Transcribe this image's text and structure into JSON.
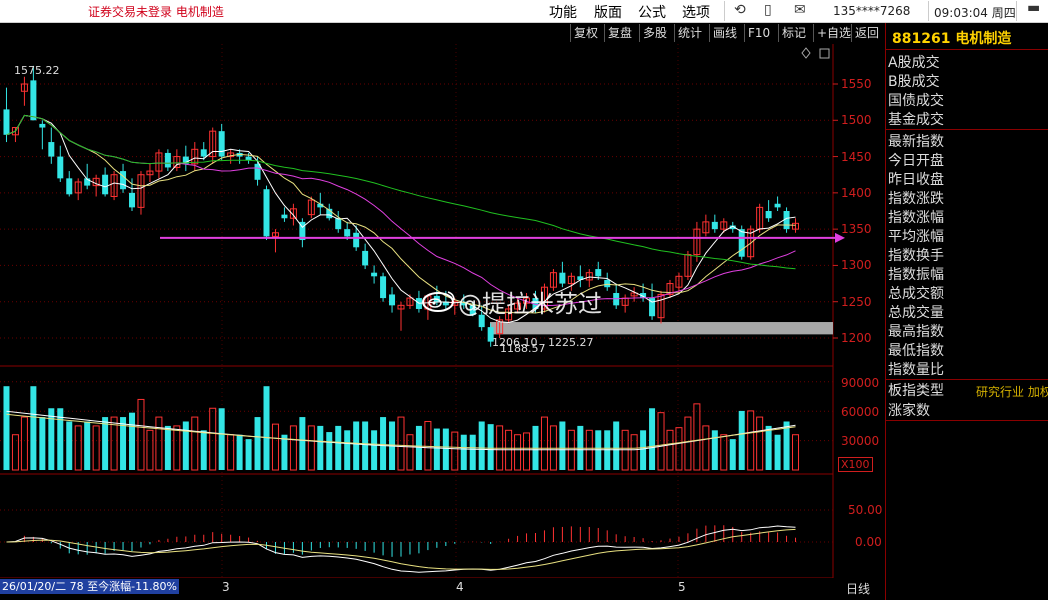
{
  "titlebar": {
    "title": "证券交易未登录   电机制造",
    "menus": [
      "功能",
      "版面",
      "公式",
      "选项"
    ],
    "account": "135****7268",
    "clock": "09:03:04 周四"
  },
  "toolbar": {
    "buttons": [
      "复权",
      "复盘",
      "多股",
      "统计",
      "画线",
      "F10",
      "标记",
      "+自选",
      "返回"
    ]
  },
  "right_panel": {
    "code": "881261",
    "name": "电机制造",
    "rows": [
      "A股成交",
      "B股成交",
      "国债成交",
      "基金成交",
      "最新指数",
      "今日开盘",
      "昨日收盘",
      "指数涨跌",
      "指数涨幅",
      "平均涨幅",
      "指数换手",
      "指数振幅",
      "总成交额",
      "总成交量",
      "最高指数",
      "最低指数",
      "指数量比",
      "板指类型",
      "涨家数"
    ],
    "type_value": "研究行业 加权"
  },
  "price_axis": [
    "1550",
    "1500",
    "1450",
    "1400",
    "1350",
    "1300",
    "1250",
    "1200"
  ],
  "volume_axis": [
    "90000",
    "60000",
    "30000"
  ],
  "volume_unit": "X100",
  "macd_axis": [
    "50.00",
    "0.00"
  ],
  "labels": {
    "high": "1575.22",
    "low": "1188.57",
    "low_pair_a": "1206.10",
    "low_pair_b": "1225.27"
  },
  "watermark": "@提拉米苏过",
  "bottom": {
    "info": "26/01/20/二 78 至今涨幅-11.80%",
    "months": [
      "3",
      "4",
      "5"
    ],
    "period": "日线"
  },
  "colors": {
    "up": "#ff3232",
    "down": "#33e5e5",
    "ma5": "#ffffff",
    "ma10": "#e8e080",
    "ma20": "#e040e0",
    "ma60": "#20c020",
    "hline": "#e040e0"
  },
  "chart_data": {
    "type": "candlestick",
    "ylim": [
      1180,
      1600
    ],
    "candles": [
      {
        "o": 1515,
        "h": 1545,
        "l": 1470,
        "c": 1480
      },
      {
        "o": 1480,
        "h": 1490,
        "l": 1470,
        "c": 1490
      },
      {
        "o": 1540,
        "h": 1560,
        "l": 1520,
        "c": 1550
      },
      {
        "o": 1555,
        "h": 1575,
        "l": 1500,
        "c": 1500
      },
      {
        "o": 1495,
        "h": 1500,
        "l": 1460,
        "c": 1490
      },
      {
        "o": 1470,
        "h": 1490,
        "l": 1440,
        "c": 1450
      },
      {
        "o": 1450,
        "h": 1465,
        "l": 1415,
        "c": 1420
      },
      {
        "o": 1420,
        "h": 1430,
        "l": 1395,
        "c": 1398
      },
      {
        "o": 1400,
        "h": 1420,
        "l": 1390,
        "c": 1415
      },
      {
        "o": 1420,
        "h": 1440,
        "l": 1405,
        "c": 1410
      },
      {
        "o": 1410,
        "h": 1425,
        "l": 1395,
        "c": 1420
      },
      {
        "o": 1425,
        "h": 1435,
        "l": 1395,
        "c": 1398
      },
      {
        "o": 1395,
        "h": 1430,
        "l": 1390,
        "c": 1425
      },
      {
        "o": 1430,
        "h": 1440,
        "l": 1400,
        "c": 1405
      },
      {
        "o": 1400,
        "h": 1420,
        "l": 1375,
        "c": 1380
      },
      {
        "o": 1380,
        "h": 1430,
        "l": 1370,
        "c": 1425
      },
      {
        "o": 1425,
        "h": 1440,
        "l": 1415,
        "c": 1430
      },
      {
        "o": 1430,
        "h": 1460,
        "l": 1420,
        "c": 1455
      },
      {
        "o": 1455,
        "h": 1460,
        "l": 1430,
        "c": 1435
      },
      {
        "o": 1435,
        "h": 1460,
        "l": 1430,
        "c": 1450
      },
      {
        "o": 1450,
        "h": 1465,
        "l": 1430,
        "c": 1440
      },
      {
        "o": 1440,
        "h": 1470,
        "l": 1430,
        "c": 1460
      },
      {
        "o": 1460,
        "h": 1470,
        "l": 1445,
        "c": 1450
      },
      {
        "o": 1450,
        "h": 1490,
        "l": 1440,
        "c": 1485
      },
      {
        "o": 1485,
        "h": 1495,
        "l": 1445,
        "c": 1450
      },
      {
        "o": 1450,
        "h": 1460,
        "l": 1440,
        "c": 1455
      },
      {
        "o": 1455,
        "h": 1460,
        "l": 1440,
        "c": 1450
      },
      {
        "o": 1450,
        "h": 1455,
        "l": 1440,
        "c": 1445
      },
      {
        "o": 1440,
        "h": 1450,
        "l": 1410,
        "c": 1418
      },
      {
        "o": 1405,
        "h": 1410,
        "l": 1335,
        "c": 1340
      },
      {
        "o": 1340,
        "h": 1350,
        "l": 1318,
        "c": 1345
      },
      {
        "o": 1370,
        "h": 1380,
        "l": 1360,
        "c": 1365
      },
      {
        "o": 1365,
        "h": 1385,
        "l": 1355,
        "c": 1378
      },
      {
        "o": 1360,
        "h": 1365,
        "l": 1325,
        "c": 1335
      },
      {
        "o": 1370,
        "h": 1395,
        "l": 1365,
        "c": 1390
      },
      {
        "o": 1385,
        "h": 1400,
        "l": 1370,
        "c": 1380
      },
      {
        "o": 1378,
        "h": 1385,
        "l": 1362,
        "c": 1365
      },
      {
        "o": 1365,
        "h": 1375,
        "l": 1345,
        "c": 1350
      },
      {
        "o": 1350,
        "h": 1360,
        "l": 1335,
        "c": 1340
      },
      {
        "o": 1345,
        "h": 1355,
        "l": 1320,
        "c": 1325
      },
      {
        "o": 1320,
        "h": 1330,
        "l": 1295,
        "c": 1300
      },
      {
        "o": 1290,
        "h": 1300,
        "l": 1275,
        "c": 1285
      },
      {
        "o": 1285,
        "h": 1290,
        "l": 1250,
        "c": 1255
      },
      {
        "o": 1260,
        "h": 1270,
        "l": 1235,
        "c": 1245
      },
      {
        "o": 1240,
        "h": 1250,
        "l": 1210,
        "c": 1245
      },
      {
        "o": 1245,
        "h": 1260,
        "l": 1240,
        "c": 1255
      },
      {
        "o": 1255,
        "h": 1265,
        "l": 1235,
        "c": 1240
      },
      {
        "o": 1240,
        "h": 1260,
        "l": 1225,
        "c": 1258
      },
      {
        "o": 1258,
        "h": 1272,
        "l": 1245,
        "c": 1250
      },
      {
        "o": 1250,
        "h": 1265,
        "l": 1238,
        "c": 1245
      },
      {
        "o": 1245,
        "h": 1255,
        "l": 1232,
        "c": 1250
      },
      {
        "o": 1250,
        "h": 1260,
        "l": 1240,
        "c": 1245
      },
      {
        "o": 1245,
        "h": 1250,
        "l": 1230,
        "c": 1232
      },
      {
        "o": 1232,
        "h": 1245,
        "l": 1210,
        "c": 1215
      },
      {
        "o": 1215,
        "h": 1220,
        "l": 1188,
        "c": 1195
      },
      {
        "o": 1206,
        "h": 1230,
        "l": 1200,
        "c": 1225
      },
      {
        "o": 1225,
        "h": 1245,
        "l": 1220,
        "c": 1240
      },
      {
        "o": 1240,
        "h": 1255,
        "l": 1235,
        "c": 1248
      },
      {
        "o": 1248,
        "h": 1262,
        "l": 1240,
        "c": 1255
      },
      {
        "o": 1255,
        "h": 1265,
        "l": 1235,
        "c": 1240
      },
      {
        "o": 1240,
        "h": 1275,
        "l": 1235,
        "c": 1270
      },
      {
        "o": 1270,
        "h": 1295,
        "l": 1265,
        "c": 1290
      },
      {
        "o": 1290,
        "h": 1305,
        "l": 1270,
        "c": 1275
      },
      {
        "o": 1275,
        "h": 1290,
        "l": 1265,
        "c": 1285
      },
      {
        "o": 1285,
        "h": 1300,
        "l": 1270,
        "c": 1280
      },
      {
        "o": 1280,
        "h": 1295,
        "l": 1270,
        "c": 1290
      },
      {
        "o": 1295,
        "h": 1305,
        "l": 1280,
        "c": 1285
      },
      {
        "o": 1280,
        "h": 1290,
        "l": 1265,
        "c": 1270
      },
      {
        "o": 1262,
        "h": 1275,
        "l": 1240,
        "c": 1245
      },
      {
        "o": 1245,
        "h": 1260,
        "l": 1235,
        "c": 1255
      },
      {
        "o": 1258,
        "h": 1270,
        "l": 1250,
        "c": 1262
      },
      {
        "o": 1262,
        "h": 1275,
        "l": 1250,
        "c": 1255
      },
      {
        "o": 1255,
        "h": 1275,
        "l": 1225,
        "c": 1230
      },
      {
        "o": 1228,
        "h": 1265,
        "l": 1220,
        "c": 1260
      },
      {
        "o": 1260,
        "h": 1280,
        "l": 1255,
        "c": 1275
      },
      {
        "o": 1270,
        "h": 1290,
        "l": 1262,
        "c": 1285
      },
      {
        "o": 1285,
        "h": 1320,
        "l": 1280,
        "c": 1315
      },
      {
        "o": 1315,
        "h": 1360,
        "l": 1305,
        "c": 1350
      },
      {
        "o": 1345,
        "h": 1370,
        "l": 1340,
        "c": 1360
      },
      {
        "o": 1360,
        "h": 1370,
        "l": 1345,
        "c": 1350
      },
      {
        "o": 1350,
        "h": 1365,
        "l": 1345,
        "c": 1360
      },
      {
        "o": 1355,
        "h": 1360,
        "l": 1345,
        "c": 1350
      },
      {
        "o": 1350,
        "h": 1355,
        "l": 1308,
        "c": 1312
      },
      {
        "o": 1312,
        "h": 1355,
        "l": 1308,
        "c": 1350
      },
      {
        "o": 1350,
        "h": 1385,
        "l": 1345,
        "c": 1380
      },
      {
        "o": 1375,
        "h": 1390,
        "l": 1360,
        "c": 1365
      },
      {
        "o": 1385,
        "h": 1395,
        "l": 1375,
        "c": 1380
      },
      {
        "o": 1375,
        "h": 1380,
        "l": 1345,
        "c": 1350
      },
      {
        "o": 1350,
        "h": 1365,
        "l": 1345,
        "c": 1358
      }
    ],
    "hline": 1338,
    "volume_ylim": [
      0,
      100000
    ],
    "macd_ylim": [
      -70,
      70
    ]
  }
}
